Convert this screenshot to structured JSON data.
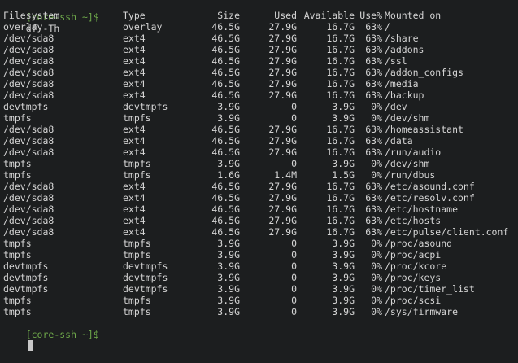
{
  "terminal": {
    "prompt": "[core-ssh ~]$",
    "command": "df -Th",
    "final_prompt": "[core-ssh ~]$",
    "headers": {
      "filesystem": "Filesystem",
      "type": "Type",
      "size": "Size",
      "used": "Used",
      "available": "Available",
      "use_pct": "Use%",
      "mounted_on": "Mounted on"
    },
    "rows": [
      {
        "filesystem": "overlay",
        "type": "overlay",
        "size": "46.5G",
        "used": "27.9G",
        "available": "16.7G",
        "use_pct": "63%",
        "mounted_on": "/"
      },
      {
        "filesystem": "/dev/sda8",
        "type": "ext4",
        "size": "46.5G",
        "used": "27.9G",
        "available": "16.7G",
        "use_pct": "63%",
        "mounted_on": "/share"
      },
      {
        "filesystem": "/dev/sda8",
        "type": "ext4",
        "size": "46.5G",
        "used": "27.9G",
        "available": "16.7G",
        "use_pct": "63%",
        "mounted_on": "/addons"
      },
      {
        "filesystem": "/dev/sda8",
        "type": "ext4",
        "size": "46.5G",
        "used": "27.9G",
        "available": "16.7G",
        "use_pct": "63%",
        "mounted_on": "/ssl"
      },
      {
        "filesystem": "/dev/sda8",
        "type": "ext4",
        "size": "46.5G",
        "used": "27.9G",
        "available": "16.7G",
        "use_pct": "63%",
        "mounted_on": "/addon_configs"
      },
      {
        "filesystem": "/dev/sda8",
        "type": "ext4",
        "size": "46.5G",
        "used": "27.9G",
        "available": "16.7G",
        "use_pct": "63%",
        "mounted_on": "/media"
      },
      {
        "filesystem": "/dev/sda8",
        "type": "ext4",
        "size": "46.5G",
        "used": "27.9G",
        "available": "16.7G",
        "use_pct": "63%",
        "mounted_on": "/backup"
      },
      {
        "filesystem": "devtmpfs",
        "type": "devtmpfs",
        "size": "3.9G",
        "used": "0",
        "available": "3.9G",
        "use_pct": "0%",
        "mounted_on": "/dev"
      },
      {
        "filesystem": "tmpfs",
        "type": "tmpfs",
        "size": "3.9G",
        "used": "0",
        "available": "3.9G",
        "use_pct": "0%",
        "mounted_on": "/dev/shm"
      },
      {
        "filesystem": "/dev/sda8",
        "type": "ext4",
        "size": "46.5G",
        "used": "27.9G",
        "available": "16.7G",
        "use_pct": "63%",
        "mounted_on": "/homeassistant"
      },
      {
        "filesystem": "/dev/sda8",
        "type": "ext4",
        "size": "46.5G",
        "used": "27.9G",
        "available": "16.7G",
        "use_pct": "63%",
        "mounted_on": "/data"
      },
      {
        "filesystem": "/dev/sda8",
        "type": "ext4",
        "size": "46.5G",
        "used": "27.9G",
        "available": "16.7G",
        "use_pct": "63%",
        "mounted_on": "/run/audio"
      },
      {
        "filesystem": "tmpfs",
        "type": "tmpfs",
        "size": "3.9G",
        "used": "0",
        "available": "3.9G",
        "use_pct": "0%",
        "mounted_on": "/dev/shm"
      },
      {
        "filesystem": "tmpfs",
        "type": "tmpfs",
        "size": "1.6G",
        "used": "1.4M",
        "available": "1.5G",
        "use_pct": "0%",
        "mounted_on": "/run/dbus"
      },
      {
        "filesystem": "/dev/sda8",
        "type": "ext4",
        "size": "46.5G",
        "used": "27.9G",
        "available": "16.7G",
        "use_pct": "63%",
        "mounted_on": "/etc/asound.conf"
      },
      {
        "filesystem": "/dev/sda8",
        "type": "ext4",
        "size": "46.5G",
        "used": "27.9G",
        "available": "16.7G",
        "use_pct": "63%",
        "mounted_on": "/etc/resolv.conf"
      },
      {
        "filesystem": "/dev/sda8",
        "type": "ext4",
        "size": "46.5G",
        "used": "27.9G",
        "available": "16.7G",
        "use_pct": "63%",
        "mounted_on": "/etc/hostname"
      },
      {
        "filesystem": "/dev/sda8",
        "type": "ext4",
        "size": "46.5G",
        "used": "27.9G",
        "available": "16.7G",
        "use_pct": "63%",
        "mounted_on": "/etc/hosts"
      },
      {
        "filesystem": "/dev/sda8",
        "type": "ext4",
        "size": "46.5G",
        "used": "27.9G",
        "available": "16.7G",
        "use_pct": "63%",
        "mounted_on": "/etc/pulse/client.conf"
      },
      {
        "filesystem": "tmpfs",
        "type": "tmpfs",
        "size": "3.9G",
        "used": "0",
        "available": "3.9G",
        "use_pct": "0%",
        "mounted_on": "/proc/asound"
      },
      {
        "filesystem": "tmpfs",
        "type": "tmpfs",
        "size": "3.9G",
        "used": "0",
        "available": "3.9G",
        "use_pct": "0%",
        "mounted_on": "/proc/acpi"
      },
      {
        "filesystem": "devtmpfs",
        "type": "devtmpfs",
        "size": "3.9G",
        "used": "0",
        "available": "3.9G",
        "use_pct": "0%",
        "mounted_on": "/proc/kcore"
      },
      {
        "filesystem": "devtmpfs",
        "type": "devtmpfs",
        "size": "3.9G",
        "used": "0",
        "available": "3.9G",
        "use_pct": "0%",
        "mounted_on": "/proc/keys"
      },
      {
        "filesystem": "devtmpfs",
        "type": "devtmpfs",
        "size": "3.9G",
        "used": "0",
        "available": "3.9G",
        "use_pct": "0%",
        "mounted_on": "/proc/timer_list"
      },
      {
        "filesystem": "tmpfs",
        "type": "tmpfs",
        "size": "3.9G",
        "used": "0",
        "available": "3.9G",
        "use_pct": "0%",
        "mounted_on": "/proc/scsi"
      },
      {
        "filesystem": "tmpfs",
        "type": "tmpfs",
        "size": "3.9G",
        "used": "0",
        "available": "3.9G",
        "use_pct": "0%",
        "mounted_on": "/sys/firmware"
      }
    ]
  },
  "colors": {
    "background": "#1c1e1f",
    "text": "#d4d4d4",
    "prompt": "#6ea84a",
    "cursor": "#c8c8c8"
  }
}
